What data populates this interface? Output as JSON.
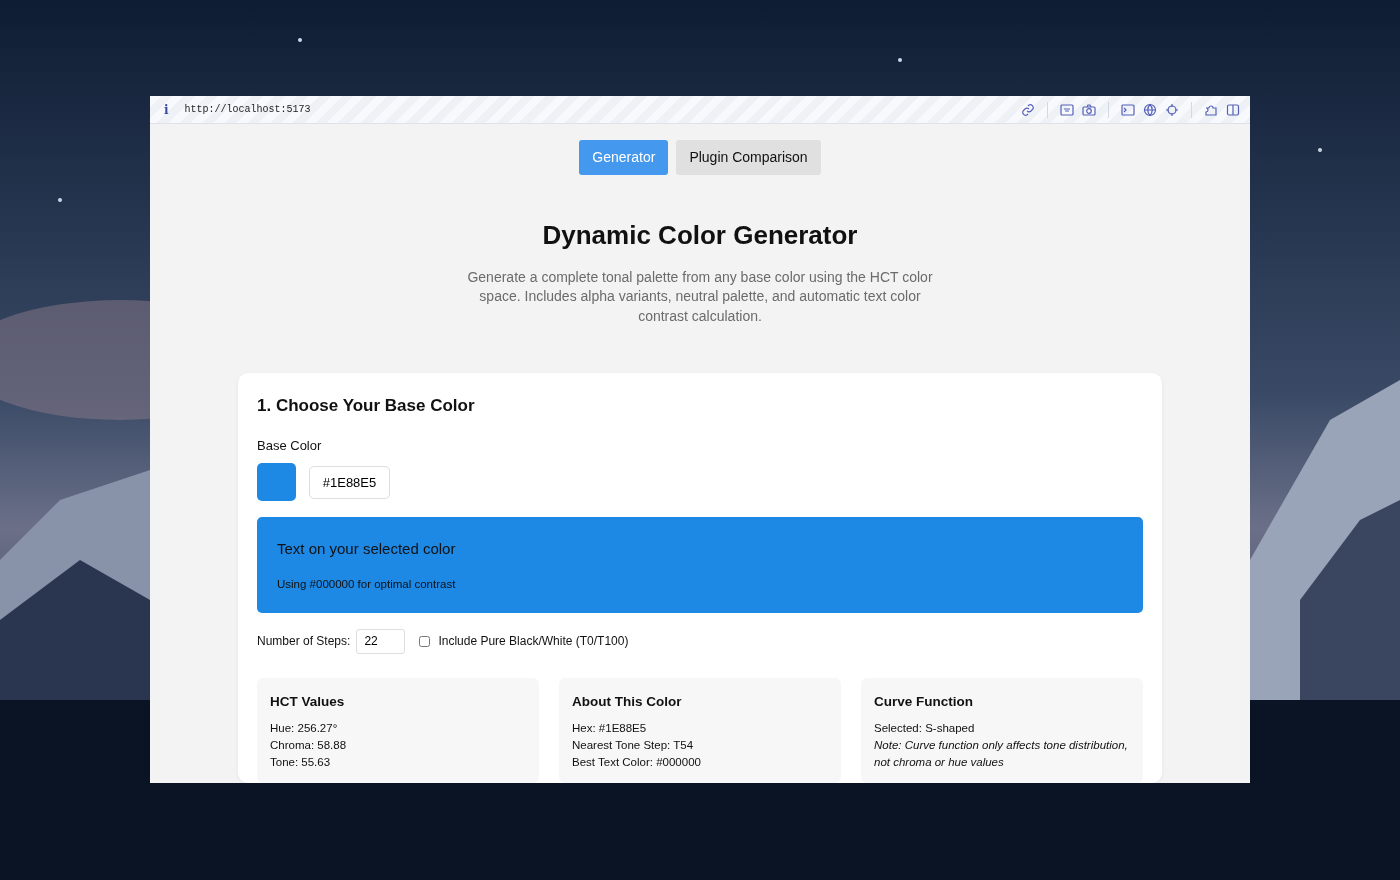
{
  "browser": {
    "info": "i",
    "url": "http://localhost:5173"
  },
  "tabs": [
    {
      "label": "Generator",
      "selected": true
    },
    {
      "label": "Plugin Comparison",
      "selected": false
    }
  ],
  "title": "Dynamic Color Generator",
  "description": "Generate a complete tonal palette from any base color using the HCT color space. Includes alpha variants, neutral palette, and automatic text color contrast calculation.",
  "section": {
    "heading": "1. Choose Your Base Color",
    "base_color_label": "Base Color",
    "hex_value": "#1E88E5",
    "preview": {
      "heading": "Text on your selected color",
      "note": "Using #000000 for optimal contrast"
    },
    "steps": {
      "label": "Number of Steps:",
      "value": "22"
    },
    "include_black_white": {
      "label": "Include Pure Black/White (T0/T100)",
      "checked": false
    },
    "info_cards": [
      {
        "title": "HCT Values",
        "lines": [
          {
            "kind": "plain",
            "text": "Hue: 256.27°"
          },
          {
            "kind": "plain",
            "text": "Chroma: 58.88"
          },
          {
            "kind": "plain",
            "text": "Tone: 55.63"
          }
        ]
      },
      {
        "title": "About This Color",
        "lines": [
          {
            "kind": "plain",
            "text": "Hex: #1E88E5"
          },
          {
            "kind": "plain",
            "text": "Nearest Tone Step: T54"
          },
          {
            "kind": "plain",
            "text": "Best Text Color: #000000"
          }
        ]
      },
      {
        "title": "Curve Function",
        "lines": [
          {
            "kind": "plain",
            "text": "Selected: S-shaped"
          },
          {
            "kind": "note",
            "text": "Note: Curve function only affects tone distribution, not chroma or hue values"
          }
        ]
      }
    ]
  }
}
